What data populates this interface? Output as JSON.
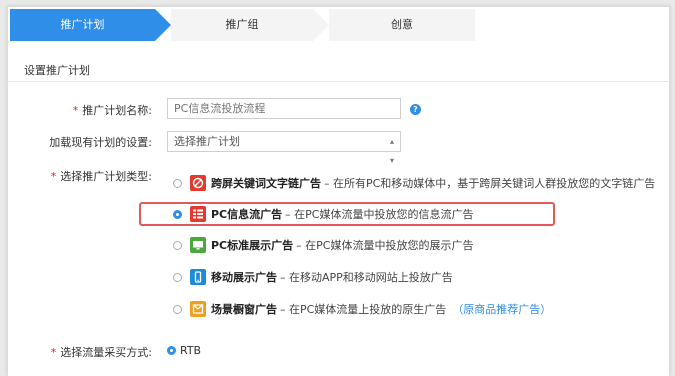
{
  "steps": [
    "推广计划",
    "推广组",
    "创意"
  ],
  "section_title": "设置推广计划",
  "form": {
    "name_label": "推广计划名称:",
    "name_placeholder": "PC信息流投放流程",
    "help_symbol": "?",
    "load_label": "加载现有计划的设置:",
    "load_value": "选择推广计划",
    "type_label": "选择推广计划类型:",
    "traffic_label": "选择流量采买方式:",
    "traffic_value": "RTB",
    "required_mark": "*"
  },
  "plan_types": [
    {
      "name": "跨屏关键词文字链广告",
      "desc": "– 在所有PC和移动媒体中，基于跨屏关键词人群投放您的文字链广告",
      "icon": "crossscreen-icon",
      "color": "#e4392f",
      "selected": false
    },
    {
      "name": "PC信息流广告",
      "desc": "– 在PC媒体流量中投放您的信息流广告",
      "icon": "feed-icon",
      "color": "#e4392f",
      "selected": true
    },
    {
      "name": "PC标准展示广告",
      "desc": "– 在PC媒体流量中投放您的展示广告",
      "icon": "monitor-icon",
      "color": "#4aa83c",
      "selected": false
    },
    {
      "name": "移动展示广告",
      "desc": "– 在移动APP和移动网站上投放广告",
      "icon": "mobile-icon",
      "color": "#1e8bd6",
      "selected": false
    },
    {
      "name": "场景橱窗广告",
      "desc": "– 在PC媒体流量上投放的原生广告",
      "link": "（原商品推荐广告）",
      "icon": "showcase-icon",
      "color": "#f0a020",
      "selected": false
    }
  ]
}
